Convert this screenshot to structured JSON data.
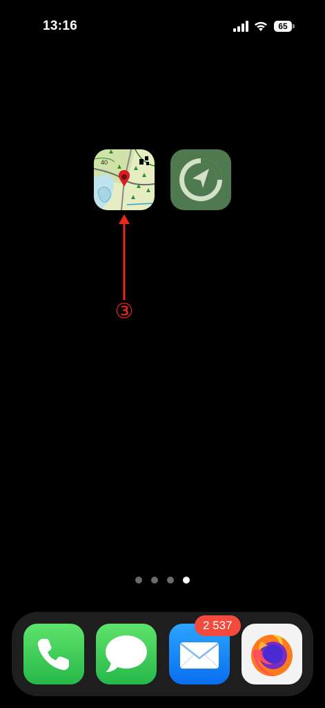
{
  "status_bar": {
    "time": "13:16",
    "battery": "65",
    "icons": [
      "signal-icon",
      "wifi-icon",
      "battery-icon"
    ]
  },
  "home": {
    "apps": [
      {
        "icon": "topographic-map-app-icon"
      },
      {
        "icon": "navigation-compass-app-icon"
      }
    ],
    "annotation": {
      "label": "③",
      "color": "#e8291c"
    },
    "page_dots": {
      "total": 4,
      "active_index": 3
    }
  },
  "dock": {
    "apps": [
      {
        "icon": "phone-icon"
      },
      {
        "icon": "messages-icon"
      },
      {
        "icon": "mail-icon",
        "badge": "2 537"
      },
      {
        "icon": "firefox-icon"
      }
    ]
  },
  "colors": {
    "background": "#000000",
    "dock": "#1e1e1e",
    "badge": "#f24a3d",
    "nav_app": "#4f7a4f"
  }
}
